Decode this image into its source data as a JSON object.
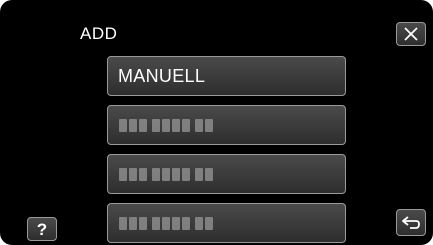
{
  "header": {
    "title": "ADD"
  },
  "options": {
    "manual_label": "MANUELL",
    "masked_entries": [
      "masked-entry",
      "masked-entry",
      "masked-entry"
    ]
  },
  "icons": {
    "close": "close-icon",
    "help": "help-icon",
    "back": "back-arrow-icon"
  },
  "help": {
    "label": "?"
  }
}
